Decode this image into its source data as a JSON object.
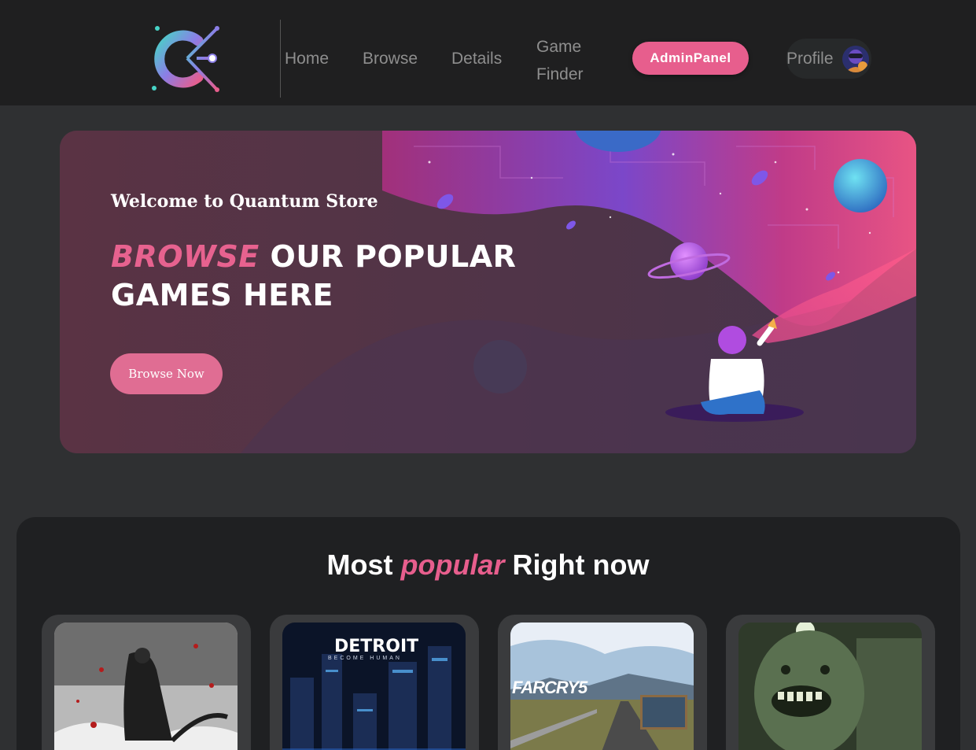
{
  "nav": {
    "home": "Home",
    "browse": "Browse",
    "details": "Details",
    "game_finder_line1": "Game",
    "game_finder_line2": "Finder",
    "admin_panel": "AdminPanel",
    "profile": "Profile"
  },
  "banner": {
    "welcome": "Welcome to Quantum Store",
    "headline_accent": "BROWSE",
    "headline_rest1": " OUR POPULAR",
    "headline_rest2": "GAMES HERE",
    "cta": "Browse Now"
  },
  "popular": {
    "title_prefix": "Most ",
    "title_accent": "popular",
    "title_suffix": " Right now",
    "cards": [
      {
        "icon": "ghost-of-tsushima-cover"
      },
      {
        "icon": "detroit-become-human-cover",
        "title": "DETROIT",
        "subtitle": "BECOME HUMAN"
      },
      {
        "icon": "far-cry-5-cover",
        "title": "FARCRY5"
      },
      {
        "icon": "outlast-cover"
      }
    ]
  },
  "colors": {
    "accent": "#e75e8d",
    "header_bg": "#1f1f20",
    "page_bg": "#2f3032",
    "section_bg": "#1f2022"
  }
}
